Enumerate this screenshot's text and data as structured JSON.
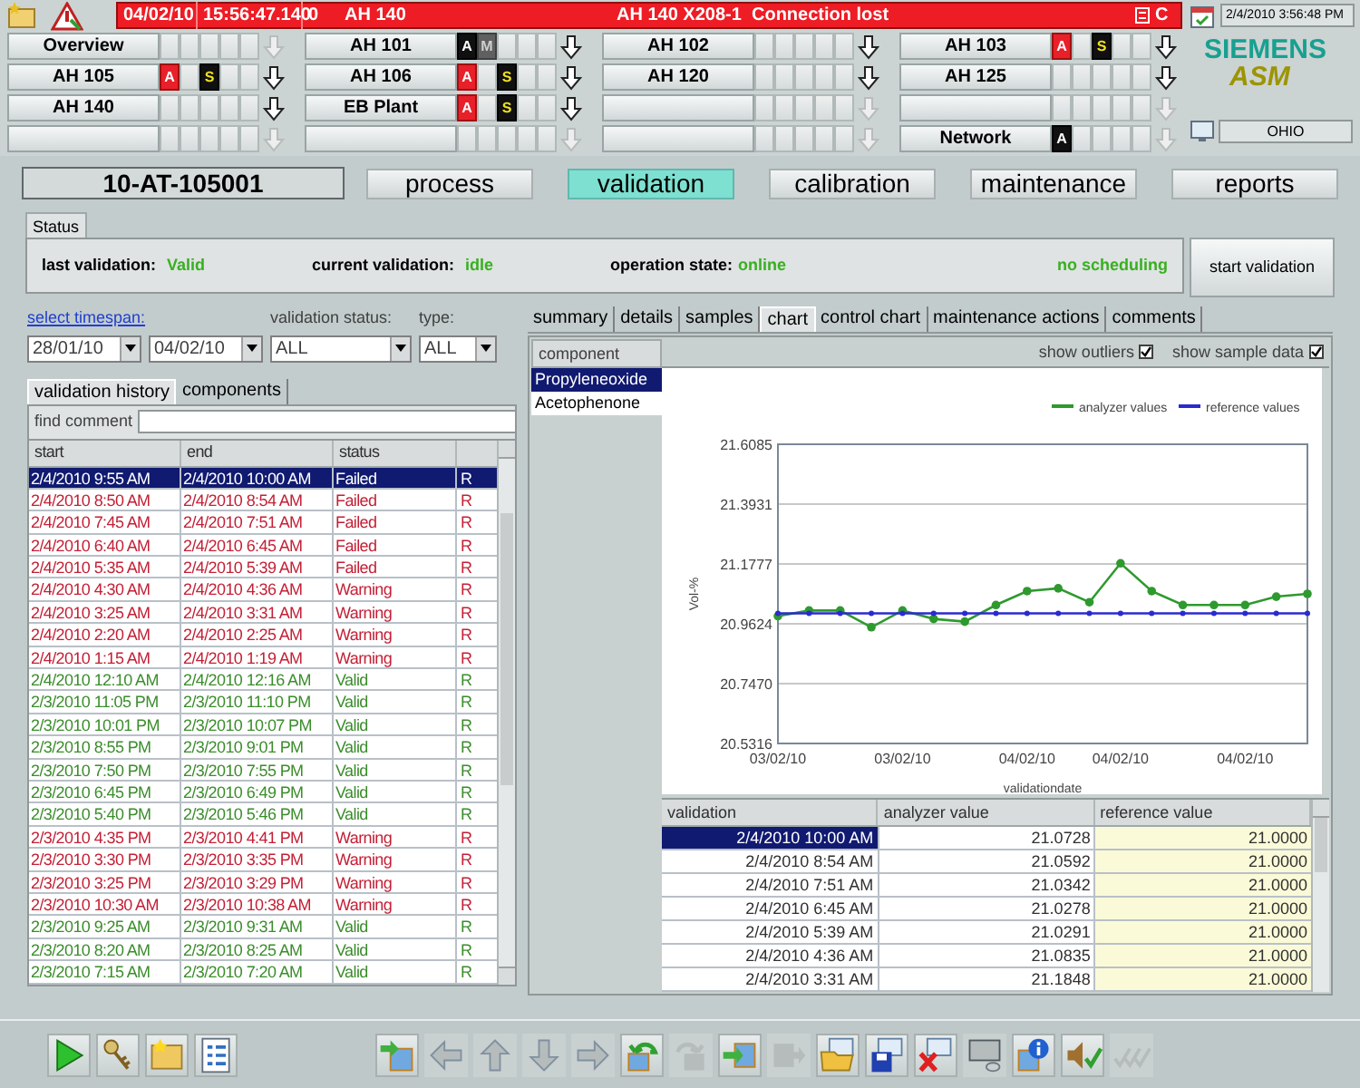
{
  "alarm_bar": {
    "date": "04/02/10",
    "time": "15:56:47.140",
    "count": "0",
    "area": "AH 140",
    "message": "AH 140 X208-1  Connection lost",
    "class": "C"
  },
  "clock": "2/4/2010 3:56:48 PM",
  "logo": {
    "brand": "SIEMENS",
    "product": "ASM"
  },
  "station": "OHIO",
  "area_rows": [
    [
      {
        "label": "Overview",
        "arrow_enabled": false,
        "slots": [
          {
            "kind": "empty"
          },
          {
            "kind": "empty"
          },
          {
            "kind": "empty"
          },
          {
            "kind": "empty"
          },
          {
            "kind": "empty"
          }
        ]
      },
      {
        "label": "AH 101",
        "arrow_enabled": true,
        "slots": [
          {
            "kind": "alarm_dark",
            "letter": "A"
          },
          {
            "kind": "maint",
            "letter": "M"
          },
          {
            "kind": "empty"
          },
          {
            "kind": "empty"
          },
          {
            "kind": "empty"
          }
        ]
      },
      {
        "label": "AH 102",
        "arrow_enabled": true,
        "slots": [
          {
            "kind": "empty"
          },
          {
            "kind": "empty"
          },
          {
            "kind": "empty"
          },
          {
            "kind": "empty"
          },
          {
            "kind": "empty"
          }
        ]
      },
      {
        "label": "AH 103",
        "arrow_enabled": true,
        "slots": [
          {
            "kind": "alarm",
            "letter": "A"
          },
          {
            "kind": "empty"
          },
          {
            "kind": "service",
            "letter": "S"
          },
          {
            "kind": "empty"
          },
          {
            "kind": "empty"
          }
        ]
      }
    ],
    [
      {
        "label": "AH 105",
        "arrow_enabled": true,
        "slots": [
          {
            "kind": "alarm",
            "letter": "A"
          },
          {
            "kind": "empty"
          },
          {
            "kind": "service",
            "letter": "S"
          },
          {
            "kind": "empty"
          },
          {
            "kind": "empty"
          }
        ]
      },
      {
        "label": "AH 106",
        "arrow_enabled": true,
        "slots": [
          {
            "kind": "alarm",
            "letter": "A"
          },
          {
            "kind": "empty"
          },
          {
            "kind": "service",
            "letter": "S"
          },
          {
            "kind": "empty"
          },
          {
            "kind": "empty"
          }
        ]
      },
      {
        "label": "AH 120",
        "arrow_enabled": true,
        "slots": [
          {
            "kind": "empty"
          },
          {
            "kind": "empty"
          },
          {
            "kind": "empty"
          },
          {
            "kind": "empty"
          },
          {
            "kind": "empty"
          }
        ]
      },
      {
        "label": "AH 125",
        "arrow_enabled": true,
        "slots": [
          {
            "kind": "empty"
          },
          {
            "kind": "empty"
          },
          {
            "kind": "empty"
          },
          {
            "kind": "empty"
          },
          {
            "kind": "empty"
          }
        ]
      }
    ],
    [
      {
        "label": "AH 140",
        "arrow_enabled": true,
        "slots": [
          {
            "kind": "empty"
          },
          {
            "kind": "empty"
          },
          {
            "kind": "empty"
          },
          {
            "kind": "empty"
          },
          {
            "kind": "empty"
          }
        ]
      },
      {
        "label": "EB Plant",
        "arrow_enabled": true,
        "slots": [
          {
            "kind": "alarm",
            "letter": "A"
          },
          {
            "kind": "empty"
          },
          {
            "kind": "service",
            "letter": "S"
          },
          {
            "kind": "empty"
          },
          {
            "kind": "empty"
          }
        ]
      },
      {
        "arrow_enabled": false,
        "slots": [
          {
            "kind": "empty"
          },
          {
            "kind": "empty"
          },
          {
            "kind": "empty"
          },
          {
            "kind": "empty"
          },
          {
            "kind": "empty"
          }
        ]
      },
      {
        "arrow_enabled": false,
        "slots": [
          {
            "kind": "empty"
          },
          {
            "kind": "empty"
          },
          {
            "kind": "empty"
          },
          {
            "kind": "empty"
          },
          {
            "kind": "empty"
          }
        ]
      }
    ],
    [
      {
        "arrow_enabled": false,
        "slots": [
          {
            "kind": "empty"
          },
          {
            "kind": "empty"
          },
          {
            "kind": "empty"
          },
          {
            "kind": "empty"
          },
          {
            "kind": "empty"
          }
        ]
      },
      {
        "arrow_enabled": false,
        "slots": [
          {
            "kind": "empty"
          },
          {
            "kind": "empty"
          },
          {
            "kind": "empty"
          },
          {
            "kind": "empty"
          },
          {
            "kind": "empty"
          }
        ]
      },
      {
        "arrow_enabled": false,
        "slots": [
          {
            "kind": "empty"
          },
          {
            "kind": "empty"
          },
          {
            "kind": "empty"
          },
          {
            "kind": "empty"
          },
          {
            "kind": "empty"
          }
        ]
      },
      {
        "label": "Network",
        "arrow_enabled": false,
        "slots": [
          {
            "kind": "alarm_dark",
            "letter": "A"
          },
          {
            "kind": "empty"
          },
          {
            "kind": "empty"
          },
          {
            "kind": "empty"
          },
          {
            "kind": "empty"
          }
        ]
      }
    ]
  ],
  "instrument": "10-AT-105001",
  "nav_tabs": [
    {
      "label": "process",
      "selected": false
    },
    {
      "label": "validation",
      "selected": true
    },
    {
      "label": "calibration",
      "selected": false
    },
    {
      "label": "maintenance",
      "selected": false
    },
    {
      "label": "reports",
      "selected": false
    }
  ],
  "status_panel": {
    "tab": "Status",
    "last_validation_label": "last validation:",
    "last_validation": "Valid",
    "current_validation_label": "current validation:",
    "current_validation": "idle",
    "operation_state_label": "operation state:",
    "operation_state": "online",
    "scheduling": "no scheduling",
    "button": "start validation"
  },
  "filters": {
    "timespan_link": "select timespan:",
    "from": "28/01/10",
    "to": "04/02/10",
    "status_label": "validation status:",
    "status": "ALL",
    "type_label": "type:",
    "type": "ALL"
  },
  "left_tabs": [
    {
      "label": "validation history",
      "selected": true
    },
    {
      "label": "components",
      "selected": false
    }
  ],
  "find_comment": {
    "label": "find comment"
  },
  "history": {
    "columns": [
      "start",
      "end",
      "status"
    ],
    "rows": [
      {
        "start": "2/4/2010 9:55 AM",
        "end": "2/4/2010 10:00 AM",
        "status": "Failed",
        "column_4": "R",
        "selected": true
      },
      {
        "start": "2/4/2010 8:50 AM",
        "end": "2/4/2010 8:54 AM",
        "status": "Failed",
        "column_4": "R",
        "kind": "failed",
        "selected": false
      },
      {
        "start": "2/4/2010 7:45 AM",
        "end": "2/4/2010 7:51 AM",
        "status": "Failed",
        "column_4": "R",
        "kind": "failed",
        "selected": false
      },
      {
        "start": "2/4/2010 6:40 AM",
        "end": "2/4/2010 6:45 AM",
        "status": "Failed",
        "column_4": "R",
        "kind": "failed",
        "selected": false
      },
      {
        "start": "2/4/2010 5:35 AM",
        "end": "2/4/2010 5:39 AM",
        "status": "Failed",
        "column_4": "R",
        "kind": "failed",
        "selected": false
      },
      {
        "start": "2/4/2010 4:30 AM",
        "end": "2/4/2010 4:36 AM",
        "status": "Warning",
        "column_4": "R",
        "kind": "warning",
        "selected": false
      },
      {
        "start": "2/4/2010 3:25 AM",
        "end": "2/4/2010 3:31 AM",
        "status": "Warning",
        "column_4": "R",
        "kind": "warning",
        "selected": false
      },
      {
        "start": "2/4/2010 2:20 AM",
        "end": "2/4/2010 2:25 AM",
        "status": "Warning",
        "column_4": "R",
        "kind": "warning",
        "selected": false
      },
      {
        "start": "2/4/2010 1:15 AM",
        "end": "2/4/2010 1:19 AM",
        "status": "Warning",
        "column_4": "R",
        "kind": "warning",
        "selected": false
      },
      {
        "start": "2/4/2010 12:10 AM",
        "end": "2/4/2010 12:16 AM",
        "status": "Valid",
        "column_4": "R",
        "kind": "valid",
        "selected": false
      },
      {
        "start": "2/3/2010 11:05 PM",
        "end": "2/3/2010 11:10 PM",
        "status": "Valid",
        "column_4": "R",
        "kind": "valid",
        "selected": false
      },
      {
        "start": "2/3/2010 10:01 PM",
        "end": "2/3/2010 10:07 PM",
        "status": "Valid",
        "column_4": "R",
        "kind": "valid",
        "selected": false
      },
      {
        "start": "2/3/2010 8:55 PM",
        "end": "2/3/2010 9:01 PM",
        "status": "Valid",
        "column_4": "R",
        "kind": "valid",
        "selected": false
      },
      {
        "start": "2/3/2010 7:50 PM",
        "end": "2/3/2010 7:55 PM",
        "status": "Valid",
        "column_4": "R",
        "kind": "valid",
        "selected": false
      },
      {
        "start": "2/3/2010 6:45 PM",
        "end": "2/3/2010 6:49 PM",
        "status": "Valid",
        "column_4": "R",
        "kind": "valid",
        "selected": false
      },
      {
        "start": "2/3/2010 5:40 PM",
        "end": "2/3/2010 5:46 PM",
        "status": "Valid",
        "column_4": "R",
        "kind": "valid",
        "selected": false
      },
      {
        "start": "2/3/2010 4:35 PM",
        "end": "2/3/2010 4:41 PM",
        "status": "Warning",
        "column_4": "R",
        "kind": "warning",
        "selected": false
      },
      {
        "start": "2/3/2010 3:30 PM",
        "end": "2/3/2010 3:35 PM",
        "status": "Warning",
        "column_4": "R",
        "kind": "warning",
        "selected": false
      },
      {
        "start": "2/3/2010 3:25 PM",
        "end": "2/3/2010 3:29 PM",
        "status": "Warning",
        "column_4": "R",
        "kind": "warning",
        "selected": false
      },
      {
        "start": "2/3/2010 10:30 AM",
        "end": "2/3/2010 10:38 AM",
        "status": "Warning",
        "column_4": "R",
        "kind": "warning",
        "selected": false
      },
      {
        "start": "2/3/2010 9:25 AM",
        "end": "2/3/2010 9:31 AM",
        "status": "Valid",
        "column_4": "R",
        "kind": "valid",
        "selected": false
      },
      {
        "start": "2/3/2010 8:20 AM",
        "end": "2/3/2010 8:25 AM",
        "status": "Valid",
        "column_4": "R",
        "kind": "valid",
        "selected": false
      },
      {
        "start": "2/3/2010 7:15 AM",
        "end": "2/3/2010 7:20 AM",
        "status": "Valid",
        "column_4": "R",
        "kind": "valid",
        "selected": false
      }
    ]
  },
  "detail_tabs": [
    {
      "label": "summary",
      "selected": false
    },
    {
      "label": "details",
      "selected": false
    },
    {
      "label": "samples",
      "selected": false
    },
    {
      "label": "chart",
      "selected": true
    },
    {
      "label": "control chart",
      "selected": false
    },
    {
      "label": "maintenance actions",
      "selected": false
    },
    {
      "label": "comments",
      "selected": false
    }
  ],
  "components": {
    "header": "component",
    "items": [
      {
        "label": "Propyleneoxide",
        "selected": true
      },
      {
        "label": "Acetophenone",
        "selected": false
      }
    ]
  },
  "options": [
    {
      "label": "show outliers",
      "checked": true
    },
    {
      "label": "show sample data",
      "checked": true
    }
  ],
  "chart": {
    "chart_data": {
      "type": "line",
      "xlabel": "validationdate",
      "ylabel": "Vol-%",
      "categories": [
        "03/02/10",
        null,
        null,
        null,
        "03/02/10",
        null,
        null,
        null,
        "04/02/10",
        null,
        null,
        "04/02/10",
        null,
        null,
        null,
        "04/02/10",
        null,
        null
      ],
      "series": [
        {
          "name": "analyzer values",
          "color": "#2e9a2e",
          "marker": "circle",
          "values": [
            20.99,
            21.01,
            21.01,
            20.95,
            21.01,
            20.98,
            20.97,
            21.03,
            21.08,
            21.09,
            21.04,
            21.18,
            21.08,
            21.03,
            21.03,
            21.03,
            21.06,
            21.07
          ]
        },
        {
          "name": "reference values",
          "color": "#2a2ad0",
          "marker": "circle",
          "values": [
            21.0,
            21.0,
            21.0,
            21.0,
            21.0,
            21.0,
            21.0,
            21.0,
            21.0,
            21.0,
            21.0,
            21.0,
            21.0,
            21.0,
            21.0,
            21.0,
            21.0,
            21.0
          ]
        }
      ],
      "ylim": [
        20.5316,
        21.6085
      ],
      "grid": true,
      "legend": "upper right",
      "yticks": [
        {
          "value": 20.5316,
          "label": "20.5316"
        },
        {
          "value": 20.747,
          "label": "20.7470"
        },
        {
          "value": 20.9624,
          "label": "20.9624"
        },
        {
          "value": 21.1777,
          "label": "21.1777"
        },
        {
          "value": 21.3931,
          "label": "21.3931"
        },
        {
          "value": 21.6085,
          "label": "21.6085"
        }
      ]
    }
  },
  "values_table": {
    "columns": [
      "validation",
      "analyzer value",
      "reference value"
    ],
    "rows": [
      {
        "validation": "2/4/2010 10:00 AM",
        "analyzer": "21.0728",
        "reference": "21.0000",
        "selected": true
      },
      {
        "validation": "2/4/2010 8:54 AM",
        "analyzer": "21.0592",
        "reference": "21.0000",
        "selected": false
      },
      {
        "validation": "2/4/2010 7:51 AM",
        "analyzer": "21.0342",
        "reference": "21.0000",
        "selected": false
      },
      {
        "validation": "2/4/2010 6:45 AM",
        "analyzer": "21.0278",
        "reference": "21.0000",
        "selected": false
      },
      {
        "validation": "2/4/2010 5:39 AM",
        "analyzer": "21.0291",
        "reference": "21.0000",
        "selected": false
      },
      {
        "validation": "2/4/2010 4:36 AM",
        "analyzer": "21.0835",
        "reference": "21.0000",
        "selected": false
      },
      {
        "validation": "2/4/2010 3:31 AM",
        "analyzer": "21.1848",
        "reference": "21.0000",
        "selected": false
      }
    ]
  },
  "toolbar": [
    {
      "kind": "play",
      "disabled": false
    },
    {
      "kind": "keys",
      "disabled": false
    },
    {
      "kind": "star-folder",
      "disabled": false
    },
    {
      "kind": "checklist",
      "disabled": false
    },
    {
      "kind": "gap"
    },
    {
      "kind": "import",
      "disabled": false
    },
    {
      "kind": "left",
      "disabled": true
    },
    {
      "kind": "up",
      "disabled": true
    },
    {
      "kind": "down",
      "disabled": true
    },
    {
      "kind": "right",
      "disabled": true
    },
    {
      "kind": "undo",
      "disabled": false
    },
    {
      "kind": "redo",
      "disabled": true
    },
    {
      "kind": "enter",
      "disabled": false
    },
    {
      "kind": "exit",
      "disabled": true
    },
    {
      "kind": "open",
      "disabled": false
    },
    {
      "kind": "save",
      "disabled": false
    },
    {
      "kind": "delete",
      "disabled": false
    },
    {
      "kind": "monitor",
      "disabled": true
    },
    {
      "kind": "info",
      "disabled": false
    },
    {
      "kind": "sound",
      "disabled": false
    },
    {
      "kind": "checks",
      "disabled": true
    }
  ]
}
